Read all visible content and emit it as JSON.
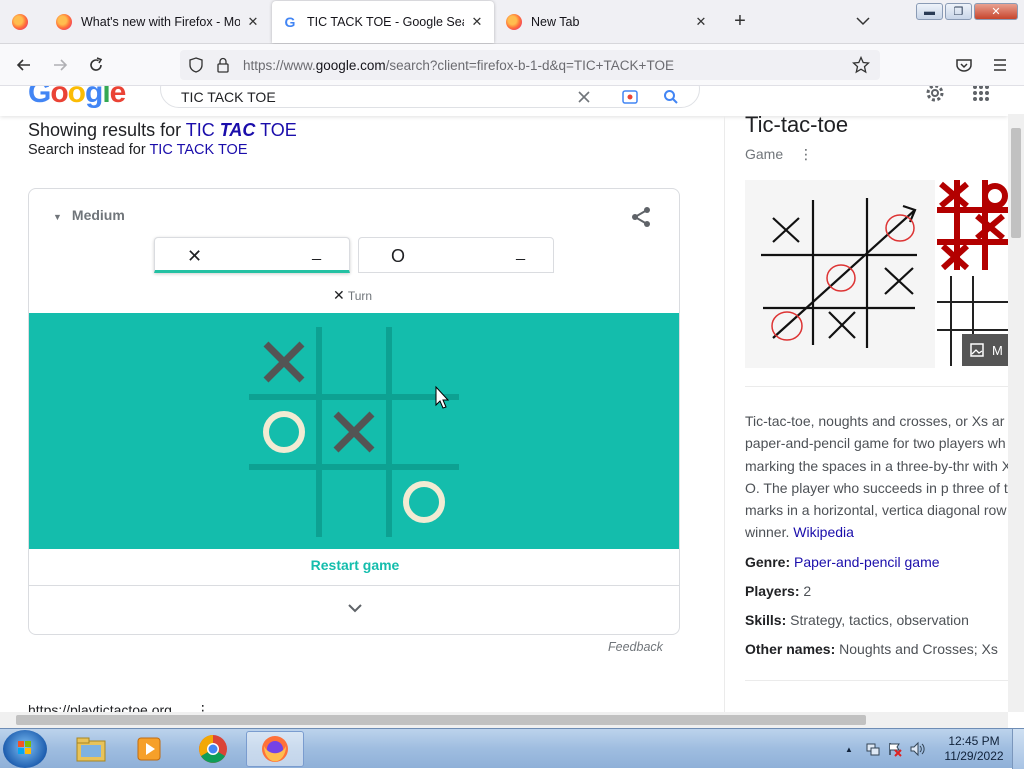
{
  "browser": {
    "tabs": [
      {
        "title": "What's new with Firefox - More",
        "icon": "firefox-icon",
        "active": false
      },
      {
        "title": "TIC TACK TOE - Google Search",
        "icon": "google-icon",
        "active": true
      },
      {
        "title": "New Tab",
        "icon": "firefox-icon",
        "active": false
      }
    ],
    "url_prefix": "https://www.",
    "url_domain": "google.com",
    "url_suffix": "/search?client=firefox-b-1-d&q=TIC+TACK+TOE",
    "close_glyph": "✕",
    "new_tab_glyph": "+",
    "window_buttons": {
      "minimize": "▬",
      "maximize": "❐",
      "close": "✕"
    }
  },
  "google": {
    "logo_letters": [
      "G",
      "o",
      "o",
      "g",
      "l",
      "e"
    ],
    "logo_colors": [
      "#4285f4",
      "#ea4335",
      "#fbbc05",
      "#4285f4",
      "#34a853",
      "#ea4335"
    ],
    "query": "TIC TACK TOE"
  },
  "results": {
    "showing_prefix": "Showing results for ",
    "showing_q1": "TIC ",
    "showing_q2": "TAC",
    "showing_q3": " TOE",
    "instead_prefix": "Search instead for ",
    "instead_query": "TIC TACK TOE",
    "feedback": "Feedback",
    "cite_url": "https://playtictactoe.org"
  },
  "game": {
    "difficulty": "Medium",
    "player_x": {
      "symbol": "✕",
      "score": "_"
    },
    "player_o": {
      "symbol": "O",
      "score": "_"
    },
    "turn_symbol": "✕",
    "turn_label": "Turn",
    "restart_label": "Restart game",
    "board": [
      [
        "X",
        "",
        ""
      ],
      [
        "O",
        "X",
        ""
      ],
      [
        "",
        "",
        "O"
      ]
    ],
    "colors": {
      "board_bg": "#14bdac",
      "grid": "#0da192",
      "x_mark": "#545454",
      "o_mark": "#f2ebd3"
    }
  },
  "knowledge_panel": {
    "title": "Tic-tac-toe",
    "subtitle": "Game",
    "more_images_label": "M",
    "description": "Tic-tac-toe, noughts and crosses, or Xs ar paper-and-pencil game for two players wh turns marking the spaces in a three-by-thr with X or O. The player who succeeds in p three of their marks in a horizontal, vertica diagonal row is the winner.",
    "source": "Wikipedia",
    "facts": [
      {
        "label": "Genre:",
        "value": "Paper-and-pencil game",
        "link": true
      },
      {
        "label": "Players:",
        "value": "2",
        "link": false
      },
      {
        "label": "Skills:",
        "value": "Strategy, tactics, observation",
        "link": false
      },
      {
        "label": "Other names:",
        "value": "Noughts and Crosses; Xs",
        "link": false
      }
    ]
  },
  "taskbar": {
    "apps": [
      "explorer-icon",
      "media-player-icon",
      "chrome-icon",
      "firefox-icon"
    ],
    "time": "12:45 PM",
    "date": "11/29/2022",
    "tray_arrow": "▲"
  }
}
